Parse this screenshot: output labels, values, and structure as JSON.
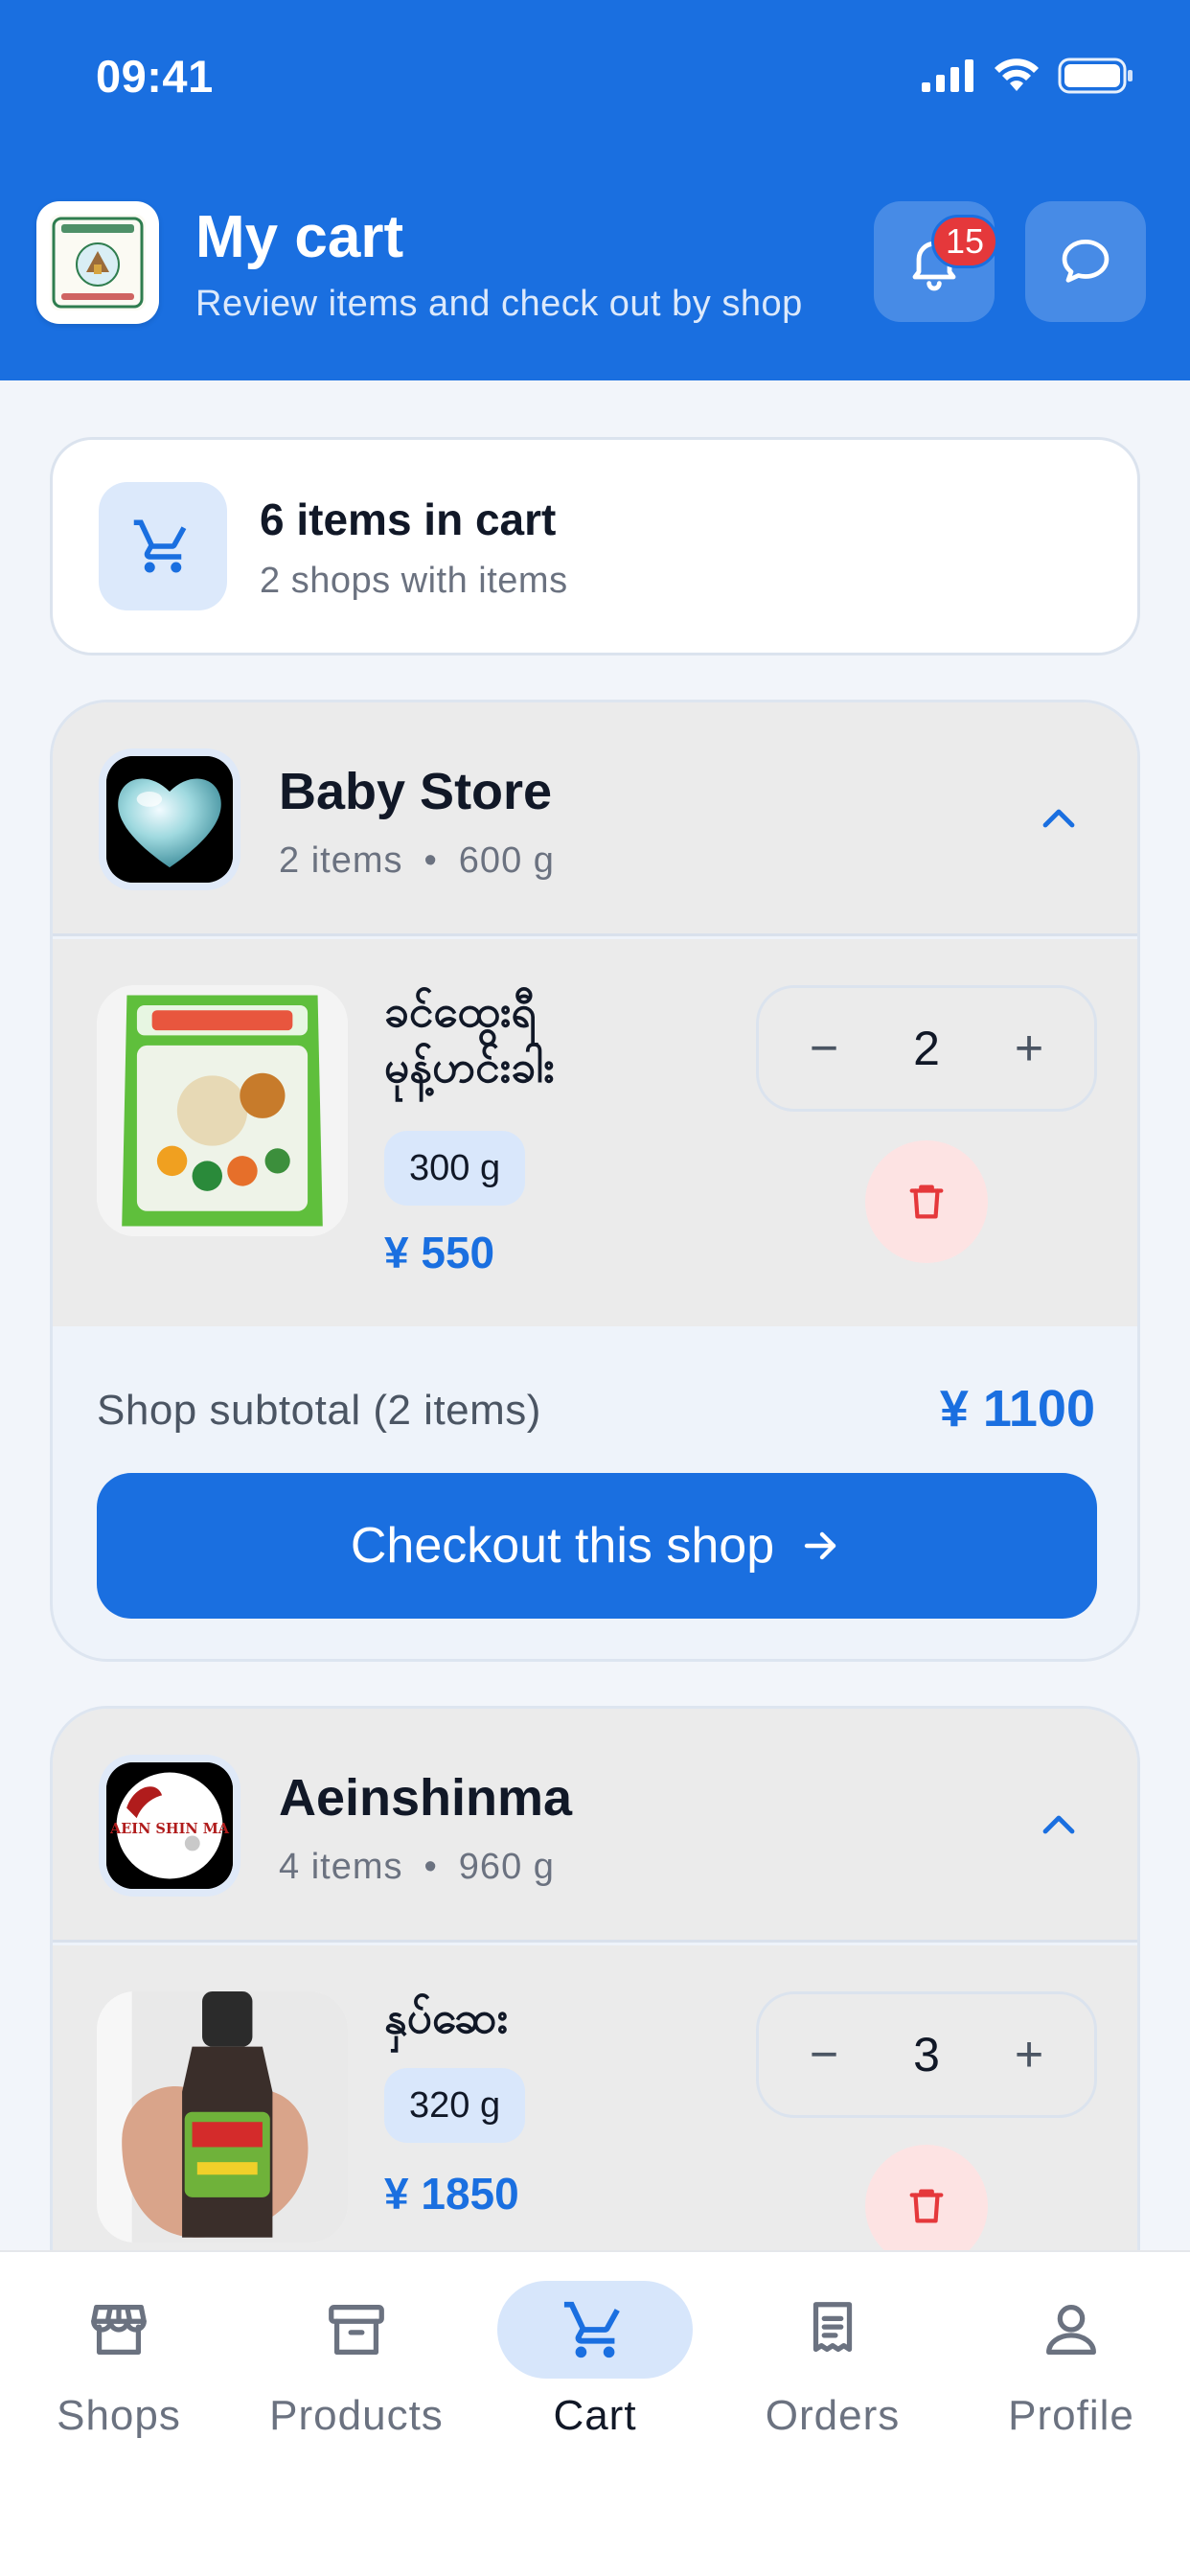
{
  "status_bar": {
    "time": "09:41"
  },
  "header": {
    "title": "My cart",
    "subtitle": "Review items and check out by shop",
    "notification_count": "15"
  },
  "summary": {
    "title": "6 items in cart",
    "subtitle": "2 shops with items"
  },
  "currency": "¥",
  "shops": [
    {
      "name": "Baby Store",
      "item_count": "2 items",
      "weight": "600 g",
      "items": [
        {
          "name": "ခင်ထွေးရီမုန့်ဟင်းခါး",
          "weight": "300 g",
          "price": "¥ 550",
          "quantity": "2"
        }
      ],
      "subtotal_label": "Shop subtotal (2 items)",
      "subtotal_value": "¥ 1100",
      "checkout_label": "Checkout this shop"
    },
    {
      "name": "Aeinshinma",
      "item_count": "4 items",
      "weight": "960 g",
      "logo_text": "AEIN SHIN MA",
      "items": [
        {
          "name": "နှပ်ဆေး",
          "weight": "320 g",
          "price": "¥ 1850",
          "quantity": "3"
        }
      ]
    }
  ],
  "bottom_nav": [
    {
      "label": "Shops",
      "icon": "store-icon",
      "active": false
    },
    {
      "label": "Products",
      "icon": "archive-box-icon",
      "active": false
    },
    {
      "label": "Cart",
      "icon": "cart-icon",
      "active": true
    },
    {
      "label": "Orders",
      "icon": "receipt-icon",
      "active": false
    },
    {
      "label": "Profile",
      "icon": "user-icon",
      "active": false
    }
  ],
  "colors": {
    "primary": "#1a6fe0",
    "danger": "#e5383b",
    "danger_bg": "#fde3e3",
    "page_bg": "#f2f5fa"
  }
}
